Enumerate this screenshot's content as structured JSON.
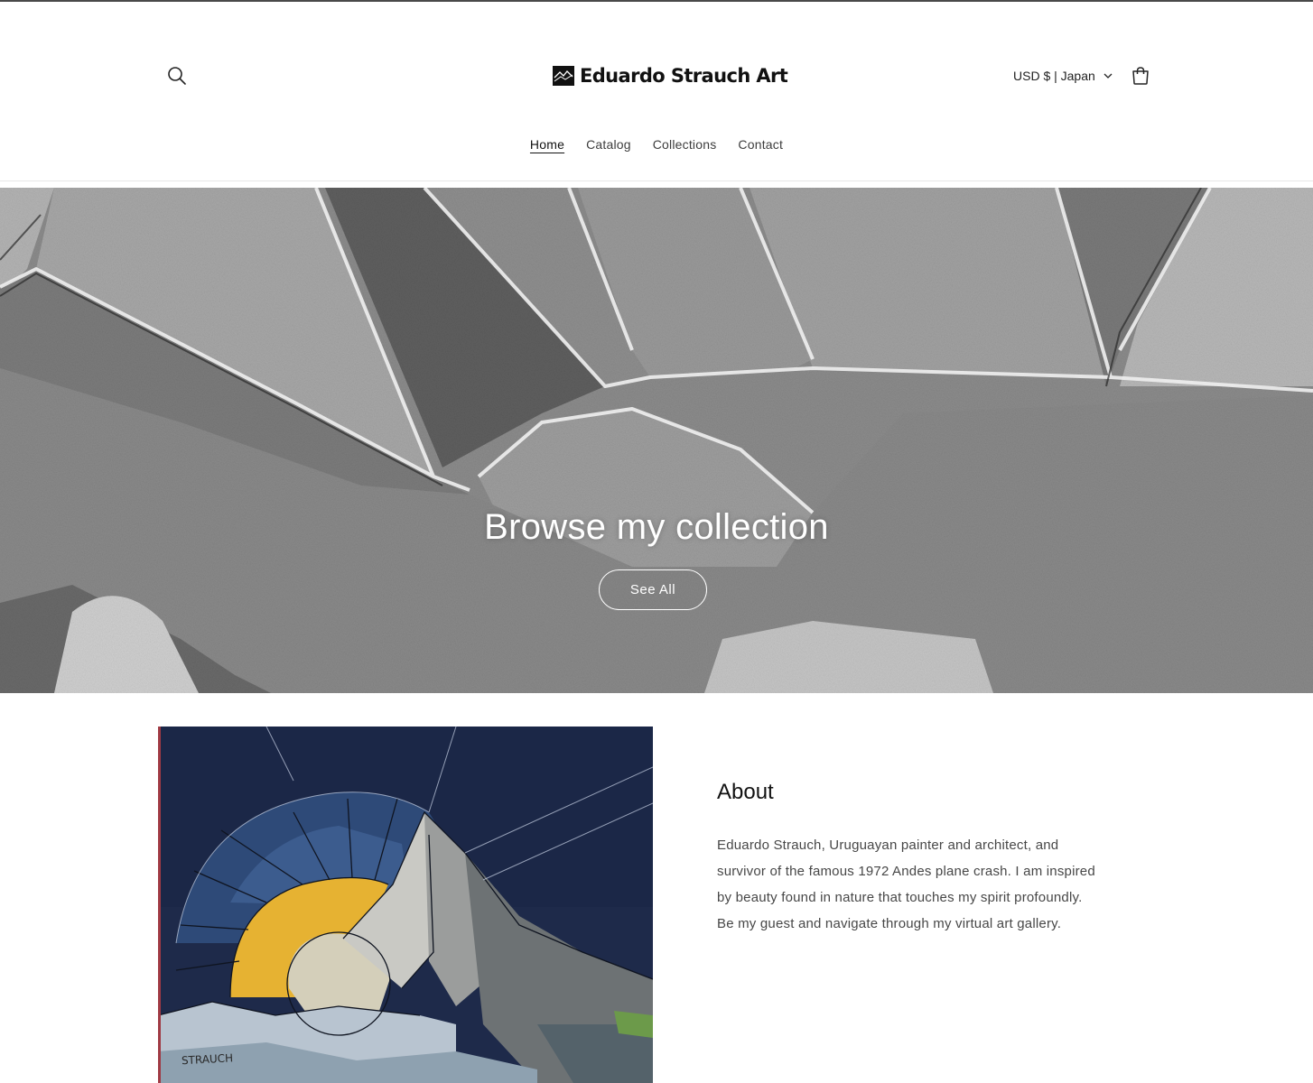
{
  "header": {
    "logo_text": "Eduardo Strauch Art",
    "currency_label": "USD $ | Japan",
    "icons": {
      "search": "search-icon",
      "cart": "cart-icon",
      "dropdown": "chevron-down-icon"
    }
  },
  "nav": {
    "items": [
      {
        "label": "Home",
        "active": true
      },
      {
        "label": "Catalog",
        "active": false
      },
      {
        "label": "Collections",
        "active": false
      },
      {
        "label": "Contact",
        "active": false
      }
    ]
  },
  "hero": {
    "title": "Browse my collection",
    "button_label": "See All"
  },
  "about": {
    "title": "About",
    "body": "Eduardo Strauch, Uruguayan painter and architect, and survivor of the famous 1972 Andes plane crash. I am inspired by beauty found in nature that touches my spirit profoundly. Be my guest and navigate through my virtual art gallery.",
    "painting_signature": "STRAUCH"
  }
}
